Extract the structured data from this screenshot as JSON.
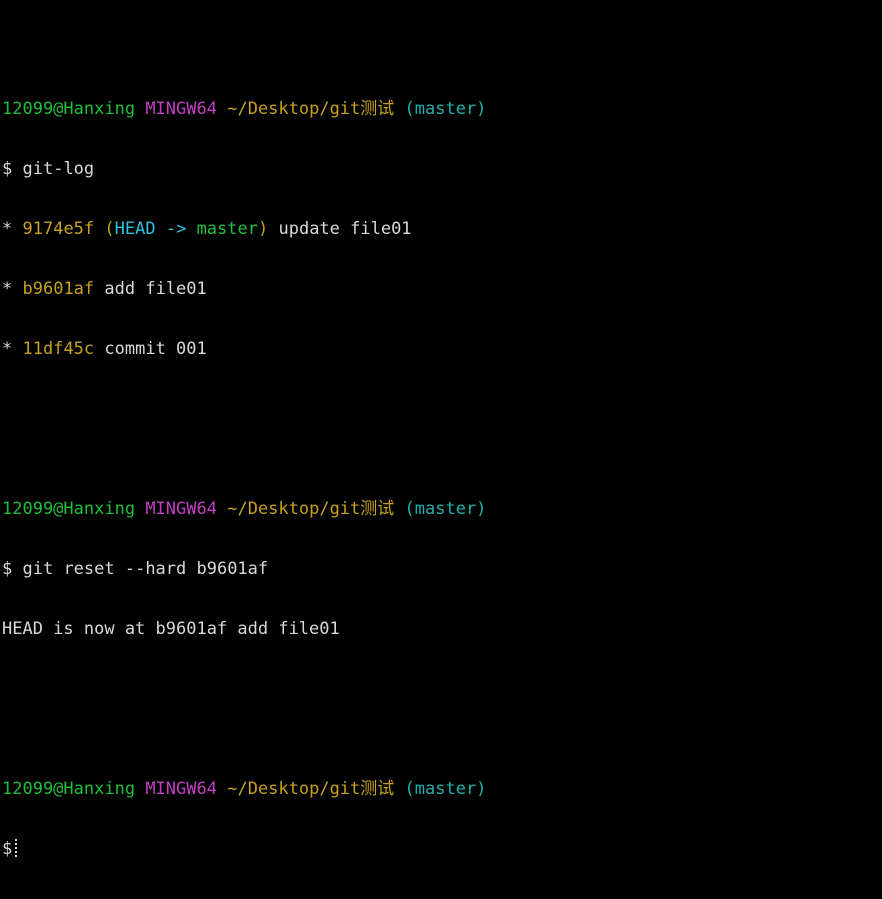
{
  "prompt": {
    "user_host": "12099@Hanxing",
    "system": "MINGW64",
    "path": "~/Desktop/git测试",
    "branch": "(master)",
    "symbol": "$"
  },
  "blocks": [
    {
      "command": "git-log",
      "log": [
        {
          "star": "*",
          "hash": "9174e5f",
          "ref_open": "(",
          "ref_head": "HEAD",
          "ref_arrow": " -> ",
          "ref_branch": "master",
          "ref_close": ")",
          "message": "update file01"
        },
        {
          "star": "*",
          "hash": "b9601af",
          "message": "add file01"
        },
        {
          "star": "*",
          "hash": "11df45c",
          "message": "commit 001"
        }
      ]
    },
    {
      "command": "git reset --hard b9601af",
      "output": "HEAD is now at b9601af add file01"
    },
    {
      "command": ""
    }
  ],
  "colors": {
    "background": "#000000",
    "text": "#d8d8d8",
    "user_host": "#1fbf3a",
    "system": "#c040c0",
    "path": "#c7a020",
    "branch": "#20b0b0"
  }
}
